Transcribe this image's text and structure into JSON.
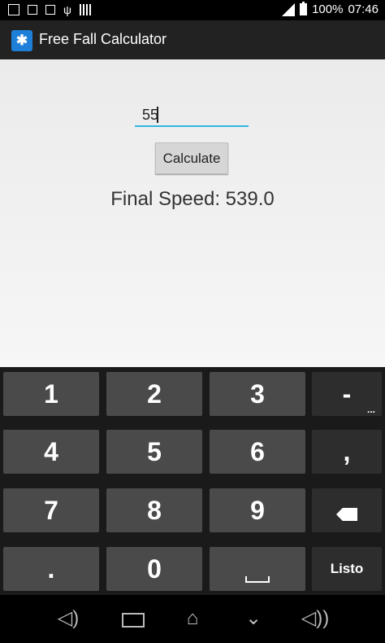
{
  "status_bar": {
    "battery_percent": "100%",
    "time": "07:46",
    "icons": [
      "image-icon",
      "keyboard-icon",
      "sd-card-icon",
      "usb-icon",
      "barcode-icon",
      "signal-icon",
      "battery-icon"
    ]
  },
  "app": {
    "title": "Free Fall Calculator",
    "icon": "skydiver-icon"
  },
  "form": {
    "input_value": "55",
    "calculate_label": "Calculate",
    "result_text": "Final Speed: 539.0"
  },
  "keyboard": {
    "rows": [
      [
        "1",
        "2",
        "3",
        "-"
      ],
      [
        "4",
        "5",
        "6",
        ","
      ],
      [
        "7",
        "8",
        "9",
        "⌫"
      ],
      [
        ".",
        "0",
        "␣",
        "Listo"
      ]
    ],
    "minus_sub": "...",
    "done_label": "Listo"
  },
  "nav": {
    "icons": [
      "volume-down-icon",
      "recent-apps-icon",
      "home-icon",
      "back-icon",
      "volume-up-icon"
    ]
  },
  "colors": {
    "accent": "#33b5e5",
    "keyboard_bg": "#1a1a1a",
    "key": "#4a4a4a",
    "key_dark": "#2d2d2d"
  }
}
